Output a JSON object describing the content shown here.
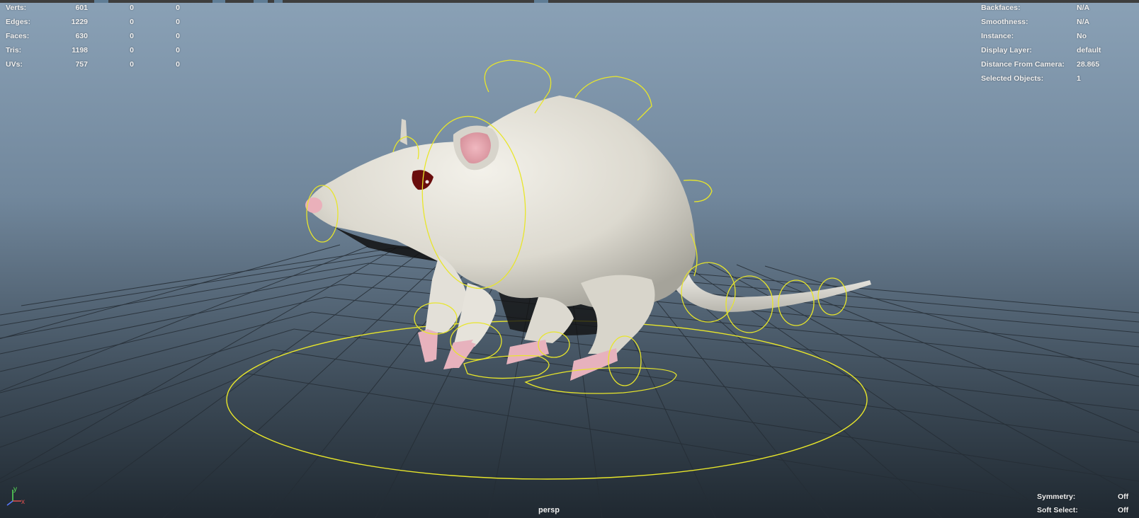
{
  "hud_stats": {
    "rows": [
      {
        "label": "Verts:",
        "c1": "601",
        "c2": "0",
        "c3": "0"
      },
      {
        "label": "Edges:",
        "c1": "1229",
        "c2": "0",
        "c3": "0"
      },
      {
        "label": "Faces:",
        "c1": "630",
        "c2": "0",
        "c3": "0"
      },
      {
        "label": "Tris:",
        "c1": "1198",
        "c2": "0",
        "c3": "0"
      },
      {
        "label": "UVs:",
        "c1": "757",
        "c2": "0",
        "c3": "0"
      }
    ]
  },
  "hud_info": {
    "rows": [
      {
        "label": "Backfaces:",
        "value": "N/A"
      },
      {
        "label": "Smoothness:",
        "value": "N/A"
      },
      {
        "label": "Instance:",
        "value": "No"
      },
      {
        "label": "Display Layer:",
        "value": "default"
      },
      {
        "label": "Distance From Camera:",
        "value": "28.865"
      },
      {
        "label": "Selected Objects:",
        "value": "1"
      }
    ]
  },
  "status": {
    "symmetry_label": "Symmetry:",
    "symmetry_value": "Off",
    "softselect_label": "Soft Select:",
    "softselect_value": "Off"
  },
  "camera": "persp",
  "axis": {
    "y": "y",
    "x": "x"
  },
  "colors": {
    "control_curve": "#e8e62a",
    "grid": "#2a323a",
    "body": "#e6e4dc",
    "pink": "#eab3bf",
    "eye": "#6a0d0d"
  }
}
